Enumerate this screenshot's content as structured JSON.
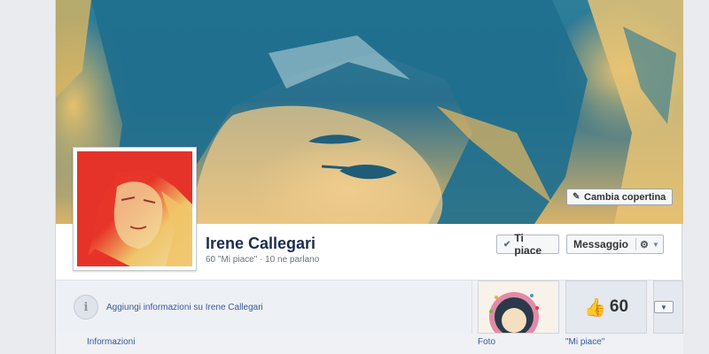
{
  "cover": {
    "change_cover_label": "Cambia copertina"
  },
  "profile": {
    "name": "Irene Callegari",
    "stats": "60 \"Mi piace\" · 10 ne parlano"
  },
  "actions": {
    "like_label": "Ti piace",
    "message_label": "Messaggio"
  },
  "info": {
    "add_info_link": "Aggiungi informazioni su Irene Callegari",
    "icon_glyph": "i"
  },
  "apps": {
    "info_label": "Informazioni",
    "photos_label": "Foto",
    "likes_label": "\"Mi piace\"",
    "likes_count": "60"
  },
  "colors": {
    "link": "#3b5998",
    "name": "#1d2d4e",
    "cover_blue": "#2e7e9a"
  }
}
